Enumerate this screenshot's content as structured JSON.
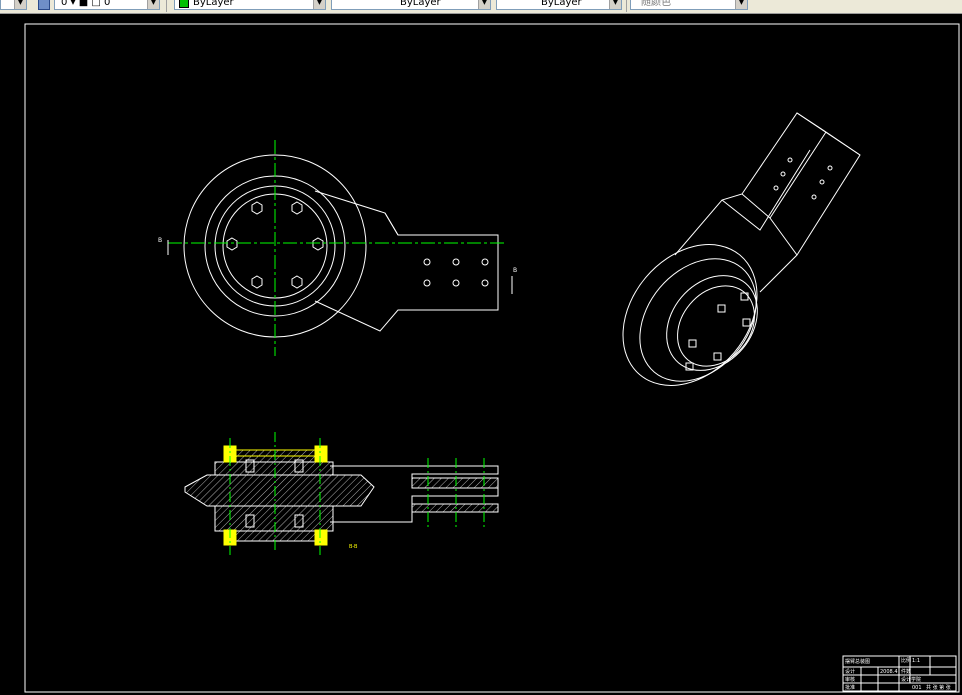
{
  "toolbar": {
    "layer_value": "0 ▾ ■ □ 0",
    "color_value": "ByLayer",
    "linetype_value": "ByLayer",
    "lineweight_value": "ByLayer",
    "plotstyle_value": "随颜色",
    "icons": [
      "layer-state-icon",
      "color-swatch-icon",
      "dropdown-arrow-icon"
    ]
  },
  "drawing": {
    "section_label_left": "B",
    "section_label_right": "B",
    "section_view_label": "B-B",
    "title_block": {
      "part_name": "摆臂总装图",
      "scale_label": "比例",
      "scale_value": "1:1",
      "sheet_label": "件数",
      "design_label": "设计",
      "date_value": "2008.4",
      "check_label": "审核",
      "approve_label": "批准",
      "drawing_no": "001",
      "sheet_text": "共 张 第 张",
      "school": "设计学院"
    }
  },
  "colors": {
    "background": "#000000",
    "lines": "#ffffff",
    "centerline": "#00ff00",
    "highlight": "#ffff00"
  }
}
